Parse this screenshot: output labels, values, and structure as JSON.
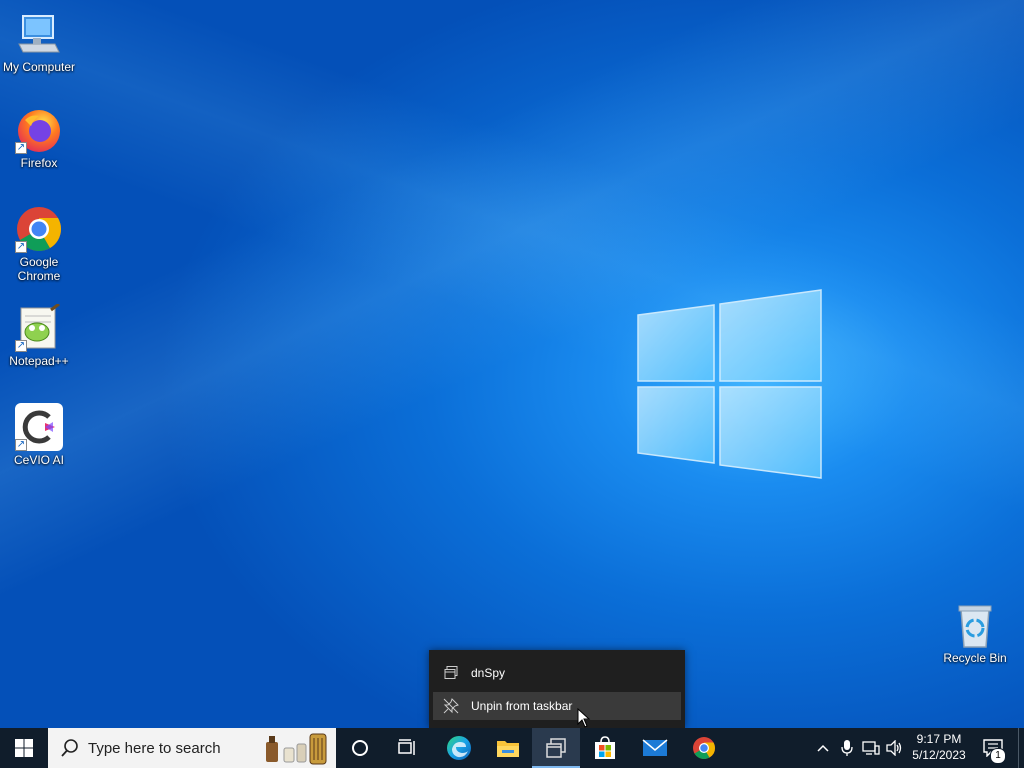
{
  "desktop": {
    "icons": [
      {
        "label": "My Computer",
        "icon": "computer-icon"
      },
      {
        "label": "Firefox",
        "icon": "firefox-icon"
      },
      {
        "label": "Google Chrome",
        "icon": "chrome-icon"
      },
      {
        "label": "Notepad++",
        "icon": "notepadpp-icon"
      },
      {
        "label": "CeVIO AI",
        "icon": "cevio-icon"
      },
      {
        "label": "Recycle Bin",
        "icon": "recycle-bin-icon"
      }
    ]
  },
  "jumplist": {
    "items": [
      {
        "label": "dnSpy",
        "icon": "dnspy-window-icon"
      },
      {
        "label": "Unpin from taskbar",
        "icon": "unpin-icon"
      }
    ]
  },
  "taskbar": {
    "search_placeholder": "Type here to search",
    "pinned": [
      {
        "name": "start",
        "icon": "windows-start-icon"
      },
      {
        "name": "cortana",
        "icon": "cortana-circle-icon"
      },
      {
        "name": "task-view",
        "icon": "task-view-icon"
      },
      {
        "name": "edge",
        "icon": "edge-icon"
      },
      {
        "name": "file-explorer",
        "icon": "folder-icon"
      },
      {
        "name": "dnspy",
        "icon": "dnspy-icon"
      },
      {
        "name": "store",
        "icon": "store-icon"
      },
      {
        "name": "mail",
        "icon": "mail-icon"
      },
      {
        "name": "chrome",
        "icon": "chrome-icon"
      }
    ],
    "tray": {
      "time": "9:17 PM",
      "date": "5/12/2023",
      "notification_count": "1"
    }
  },
  "colors": {
    "taskbar": "#101d2b",
    "menu_bg": "#1f1f1f",
    "menu_hover": "#3a3a3a",
    "desktop_blue": "#0b6fd8"
  }
}
